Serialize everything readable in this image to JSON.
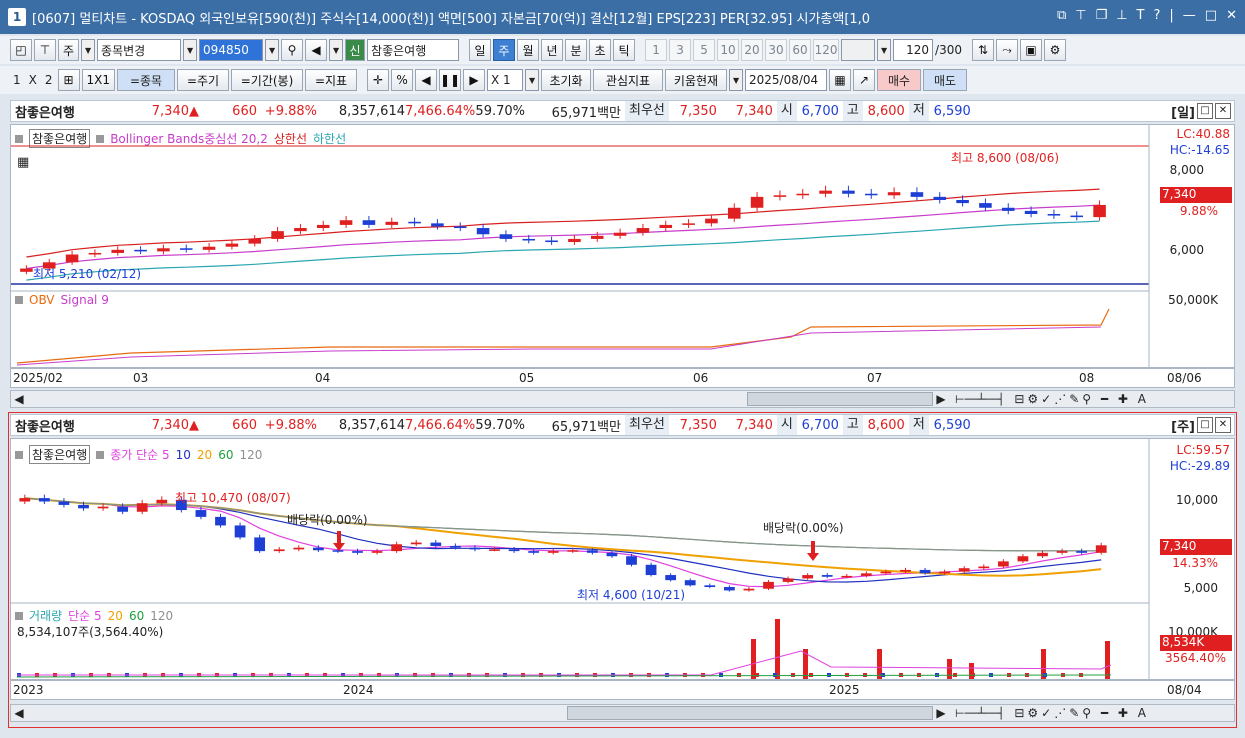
{
  "window": {
    "number": "1",
    "title": "[0607] 멀티차트 - KOSDAQ 외국인보유[590(천)] 주식수[14,000(천)] 액면[500] 자본금[70(억)] 결산[12월] EPS[223] PER[32.95] 시가총액[1,0"
  },
  "toolbar1": {
    "market": "주",
    "search_label": "종목변경",
    "code": "094850",
    "stock": "참좋은여행",
    "sin": "신",
    "periods": [
      "일",
      "주",
      "월",
      "년"
    ],
    "active_period": "주",
    "subperiods": [
      "분",
      "초",
      "틱"
    ],
    "minutes": [
      "1",
      "3",
      "5",
      "10",
      "20",
      "30",
      "60",
      "120"
    ],
    "count": "120",
    "count_total": "/300"
  },
  "toolbar2": {
    "layout_labels": [
      "1",
      "X",
      "2"
    ],
    "layout2": "1X1",
    "b_stock": "=종목",
    "b_period": "=주기",
    "b_range": "=기간(봉)",
    "b_index": "=지표",
    "pct": "%",
    "zoom": "X 1",
    "b_reset": "초기화",
    "b_watch": "관심지표",
    "b_kiwoom": "키움현재",
    "date": "2025/08/04",
    "buy": "매수",
    "sell": "매도"
  },
  "quote": {
    "name": "참좋은여행",
    "price": "7,340",
    "arrow": "▲",
    "change": "660",
    "change_pct": "+9.88%",
    "volume": "8,357,614",
    "vol_pct": "7,466.64%",
    "ratio": "59.70%",
    "amount": "65,971백만",
    "bid_label": "최우선",
    "ask": "7,350",
    "bid": "7,340",
    "open_l": "시",
    "open": "6,700",
    "high_l": "고",
    "high": "8,600",
    "low_l": "저",
    "low": "6,590"
  },
  "daily": {
    "period_tag": "[일]",
    "legend": {
      "name": "참좋은여행",
      "bb": "Bollinger Bands중심선 20,2",
      "upper": "상한선",
      "lower": "하한선"
    },
    "lc": "LC:40.88",
    "hc": "HC:-14.65",
    "y_ticks": [
      "8,000",
      "6,000"
    ],
    "tag_price": "7,340",
    "tag_pct": "9.88%",
    "max_note": "최고 8,600 (08/06)",
    "min_note": "최저 5,210 (02/12)",
    "obv_legend": {
      "obv": "OBV",
      "signal": "Signal 9"
    },
    "obv_tick": "50,000K",
    "x_labels": [
      "2025/02",
      "03",
      "04",
      "05",
      "06",
      "07",
      "08"
    ],
    "x_right": "08/06"
  },
  "weekly": {
    "period_tag": "[주]",
    "legend": {
      "name": "참좋은여행",
      "ma": "종가 단순 5",
      "p2": "10",
      "p3": "20",
      "p4": "60",
      "p5": "120"
    },
    "lc": "LC:59.57",
    "hc": "HC:-29.89",
    "y_ticks": [
      "10,000",
      "5,000"
    ],
    "tag_price": "7,340",
    "tag_pct": "14.33%",
    "max_note": "최고 10,470 (08/07)",
    "min_note": "최저 4,600 (10/21)",
    "div1": "배당락(0.00%)",
    "div2": "배당락(0.00%)",
    "vol_legend": {
      "vol": "거래량",
      "ma": "단순 5",
      "p2": "20",
      "p3": "60",
      "p4": "120"
    },
    "vol_value": "8,534,107주(3,564.40%)",
    "vol_tick": "10,000K",
    "vol_tag": "8,534K",
    "vol_tag_pct": "3564.40%",
    "x_labels": [
      "2023",
      "2024",
      "2025"
    ],
    "x_right": "08/04"
  },
  "colors": {
    "up": "#e02020",
    "down": "#1e3fd6",
    "bb_mid": "#c83ccb",
    "bb_up": "#d82020",
    "bb_low": "#2aa6b0",
    "ma5": "#e040e0",
    "ma10": "#2030c0",
    "ma20": "#f0a000",
    "ma60": "#20a040",
    "ma120": "#909090"
  },
  "chart_data": [
    {
      "type": "candlestick",
      "name": "daily",
      "ylim": [
        4900,
        9200
      ],
      "close": [
        5300,
        5500,
        5750,
        5800,
        5900,
        5850,
        5950,
        5900,
        6000,
        6100,
        6250,
        6500,
        6600,
        6700,
        6850,
        6700,
        6800,
        6750,
        6650,
        6600,
        6400,
        6250,
        6200,
        6150,
        6250,
        6350,
        6450,
        6600,
        6700,
        6750,
        6900,
        7250,
        7600,
        7650,
        7700,
        7800,
        7700,
        7650,
        7750,
        7600,
        7500,
        7400,
        7250,
        7150,
        7050,
        7000,
        6950,
        7340
      ],
      "max": 8600,
      "min": 5210
    },
    {
      "type": "candlestick",
      "name": "weekly",
      "ylim": [
        4200,
        11800
      ],
      "close": [
        10100,
        9900,
        9700,
        9500,
        9600,
        9300,
        9800,
        10000,
        9400,
        9000,
        8500,
        7800,
        7000,
        7100,
        7200,
        7050,
        7000,
        6900,
        7000,
        7400,
        7500,
        7300,
        7200,
        7100,
        7100,
        7000,
        6900,
        7000,
        7050,
        6900,
        6700,
        6200,
        5600,
        5300,
        5000,
        4900,
        4700,
        4800,
        5200,
        5400,
        5600,
        5500,
        5550,
        5700,
        5800,
        5900,
        5700,
        5800,
        6000,
        6100,
        6400,
        6700,
        6900,
        7000,
        6900,
        7340
      ],
      "max": 10470,
      "min": 4600
    }
  ]
}
